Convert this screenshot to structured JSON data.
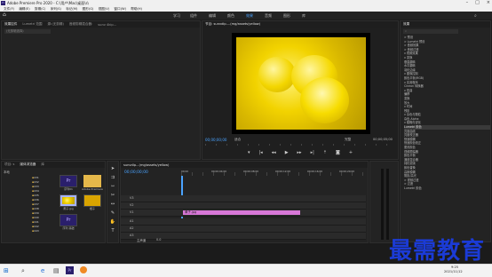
{
  "window": {
    "title": "Adobe Premiere Pro 2020 - C:\\用户\\Mac\\桌面\\s\\",
    "app_icon": "Pr"
  },
  "menu": [
    "文件(F)",
    "编辑(E)",
    "剪辑(C)",
    "序列(S)",
    "标记(M)",
    "图形(G)",
    "视图(V)",
    "窗口(W)",
    "帮助(H)"
  ],
  "workspaces": [
    "学习",
    "组件",
    "编辑",
    "颜色",
    "效果",
    "音频",
    "图形",
    "库"
  ],
  "workspace_active_index": 4,
  "source_panel": {
    "tabs": [
      "效果控件",
      "Lumetri 范围",
      "源:(无剪辑)",
      "音频剪辑混合器:",
      "sunv 4kip..."
    ],
    "search_placeholder": "(无剪辑选择)"
  },
  "program_monitor": {
    "tab": "节目: sunvdip....(mg/assets/yellow)",
    "timecode_left": "00;00;00;00",
    "fit": "适合",
    "quality": "完整",
    "timecode_right": "00;00;05;00",
    "controls": [
      "marker-icon",
      "step-back-icon",
      "prev-edit-icon",
      "play-icon",
      "next-edit-icon",
      "step-forward-icon",
      "lift-icon",
      "extract-icon",
      "export-frame-icon",
      "compare-icon",
      "settings-icon"
    ]
  },
  "effects_panel": {
    "title": "效果",
    "search_value": "",
    "tree": [
      "> 预设",
      "> Lumetri 预设",
      "> 音频效果",
      "> 音频过渡",
      "v 视频效果",
      "  v 变换",
      "      垂直翻转",
      "      水平翻转",
      "      羽化边缘",
      "  v 图像控制",
      "      颜色平衡(RGB)",
      "  v 实用程序",
      "      Cineon 转换器",
      "  v 扭曲",
      "      偏移",
      "      变换",
      "      放大",
      "  v 时间",
      "      残影",
      "  v 杂色与颗粒",
      "      杂色 Alpha",
      "  v 模糊与锐化",
      "      Lumetri 颜色",
      "      亮度曲线",
      "      亮度校正器",
      "      快速模糊",
      "      快速颜色校正",
      "      更改颜色",
      "      视频限幅器",
      "      颜色平衡",
      "      通道混合器",
      "      钝化蒙版",
      "      颜色替换",
      "      高斯模糊",
      "      阴影/高光",
      "> 视频过渡",
      "> 过渡",
      "Lumetri 颜色"
    ],
    "highlight_index": 22,
    "bottom_items": [
      "基本图形",
      "基本声音",
      "基本图形",
      "Lumetri 颜色"
    ]
  },
  "project_panel": {
    "tabs": [
      "项目: s",
      "媒体浏览器",
      "库"
    ],
    "drive_label": "本地",
    "folders": [
      "431",
      "432",
      "433",
      "434",
      "435",
      "436",
      "437",
      "438",
      "439",
      "440",
      "441",
      "442",
      "443"
    ],
    "media": [
      {
        "name": "序列01",
        "type": "premiere-icon"
      },
      {
        "name": "Adobe Premiere",
        "type": "folder-icon"
      },
      {
        "name": "黄子.jpg",
        "type": "image-thumb"
      },
      {
        "name": "橙子",
        "type": "image-thumb"
      },
      {
        "name": "序列 基础",
        "type": "premiere-icon"
      }
    ]
  },
  "timeline": {
    "tab": "sunvdip...(mg/assets/yellow)",
    "timecode": "00;00;00;00",
    "ruler_labels": [
      "00;00",
      "00;00;04;00",
      "00;00;08;00",
      "00;00;12;00",
      "00;00;16;00",
      "00;00;20;00"
    ],
    "tracks": [
      {
        "name": "V3"
      },
      {
        "name": "V2"
      },
      {
        "name": "V1"
      },
      {
        "name": "A1"
      },
      {
        "name": "A2"
      },
      {
        "name": "A3"
      }
    ],
    "master_label": "主声道",
    "master_value": "0.0",
    "clip_label": "黄子.jpg"
  },
  "tools": [
    "selection-icon",
    "track-select-icon",
    "ripple-icon",
    "razor-icon",
    "slip-icon",
    "pen-icon",
    "hand-icon",
    "type-icon"
  ],
  "taskbar": {
    "time": "9:25",
    "date": "2021/11/12"
  },
  "watermark": "最需教育",
  "colors": {
    "accent": "#4aa3ff",
    "clip": "#d878d8",
    "watermark": "#1b3bd6"
  }
}
